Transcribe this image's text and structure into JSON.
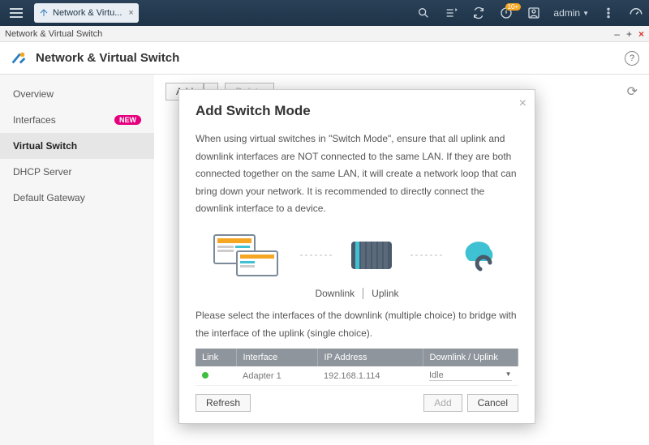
{
  "sysbar": {
    "apptab_title": "Network & Virtu...",
    "notif_badge": "10+",
    "username": "admin"
  },
  "window": {
    "title": "Network & Virtual Switch"
  },
  "appheader": {
    "title": "Network & Virtual Switch"
  },
  "sidebar": {
    "items": [
      {
        "label": "Overview"
      },
      {
        "label": "Interfaces",
        "badge": "NEW"
      },
      {
        "label": "Virtual Switch"
      },
      {
        "label": "DHCP Server"
      },
      {
        "label": "Default Gateway"
      }
    ]
  },
  "toolbar": {
    "add": "Add",
    "delete": "Delete"
  },
  "modal": {
    "title": "Add Switch Mode",
    "intro": "When using virtual switches in \"Switch Mode\", ensure that all uplink and downlink interfaces are NOT connected to the same LAN. If they are both connected together on the same LAN, it will create a network loop that can bring down your network. It is recommended to directly connect the downlink interface to a device.",
    "downlink": "Downlink",
    "uplink": "Uplink",
    "instr": "Please select the interfaces of the downlink (multiple choice) to bridge with the interface of the uplink (single choice).",
    "headers": {
      "link": "Link",
      "interface": "Interface",
      "ip": "IP Address",
      "du": "Downlink / Uplink"
    },
    "row": {
      "interface": "Adapter 1",
      "ip": "192.168.1.114",
      "du": "Idle"
    },
    "buttons": {
      "refresh": "Refresh",
      "add": "Add",
      "cancel": "Cancel"
    }
  }
}
